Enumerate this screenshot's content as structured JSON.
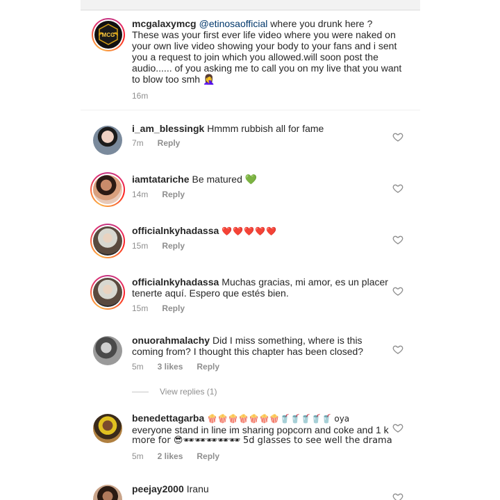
{
  "caption": {
    "username": "mcgalaxymcg",
    "mention": "@etinosaofficial",
    "lines": [
      "where you drunk here ?",
      "These was your first ever life video where you were naked on",
      "your own live video showing your body to your fans and i sent",
      "you a request to join which you allowed.will soon post the",
      "audio...... of you asking me to call you on my live that you want",
      "to blow too smh 🤦‍♀️"
    ],
    "time": "16m",
    "avatar_logo_text": "MCG"
  },
  "comments": [
    {
      "username": "i_am_blessingk",
      "text": "Hmmm rubbish all for fame",
      "time": "7m",
      "likes": "",
      "reply": "Reply",
      "ring": false
    },
    {
      "username": "iamtatariche",
      "text": "Be matured 💚",
      "time": "14m",
      "likes": "",
      "reply": "Reply",
      "ring": true
    },
    {
      "username": "officialnkyhadassa",
      "text": "❤️❤️❤️❤️❤️",
      "time": "15m",
      "likes": "",
      "reply": "Reply",
      "ring": true
    },
    {
      "username": "officialnkyhadassa",
      "text": "Muchas gracias, mi amor, es un placer",
      "text2": "tenerte aquí. Espero que estés bien.",
      "time": "15m",
      "likes": "",
      "reply": "Reply",
      "ring": true
    },
    {
      "username": "onuorahmalachy",
      "text": "Did I miss something,  where  is this",
      "text2": "coming from?  I thought this chapter has been closed?",
      "time": "5m",
      "likes": "3 likes",
      "reply": "Reply",
      "ring": false
    },
    {
      "username": "benedettagarba",
      "text": "🍿🍿🍿🍿🍿🍿🍿🥤🥤🥤🥤🥤 oya",
      "text2": "everyone stand in line im sharing popcorn and coke  and 1 k",
      "text3": "more for 😎🕶🕶🕶🕶🕶 5d glasses to see well the drama",
      "time": "5m",
      "likes": "2 likes",
      "reply": "Reply",
      "ring": false
    },
    {
      "username": "peejay2000",
      "text": "Iranu",
      "time": "",
      "likes": "",
      "reply": "",
      "ring": false
    }
  ],
  "view_replies": "View replies (1)"
}
